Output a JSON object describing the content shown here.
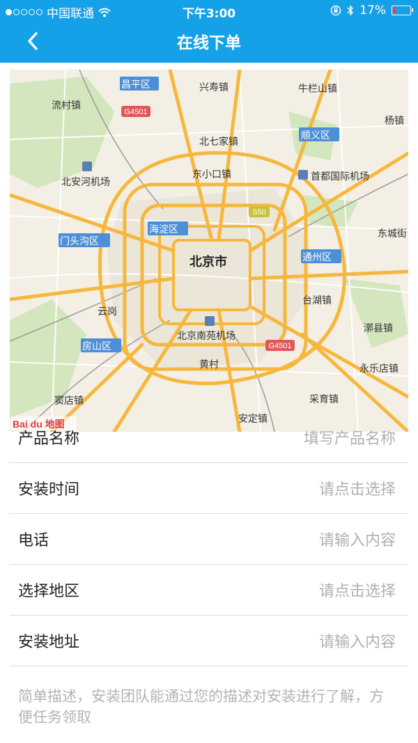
{
  "status": {
    "carrier": "中国联通",
    "time": "下午3:00",
    "battery": "17%",
    "battery_level": 0.17
  },
  "nav": {
    "title": "在线下单"
  },
  "map": {
    "logo_text": "Bai du 地图",
    "labels": [
      "昌平区",
      "兴寿镇",
      "牛栏山镇",
      "流村镇",
      "杨镇",
      "北七家镇",
      "顺义区",
      "北安河机场",
      "东小口镇",
      "首都国际机场",
      "门头沟区",
      "海淀区",
      "东城街",
      "北京市",
      "通州区",
      "台湖镇",
      "云岗",
      "房山区",
      "北京南苑机场",
      "漷县镇",
      "黄村",
      "永乐店镇",
      "窦店镇",
      "采育镇",
      "安定镇"
    ],
    "shields": [
      "G4501",
      "S50",
      "G4501"
    ]
  },
  "form": {
    "rows": [
      {
        "label": "产品名称",
        "hint": "填写产品名称"
      },
      {
        "label": "安装时间",
        "hint": "请点击选择"
      },
      {
        "label": "电话",
        "hint": "请输入内容"
      },
      {
        "label": "选择地区",
        "hint": "请点击选择"
      },
      {
        "label": "安装地址",
        "hint": "请输入内容"
      }
    ],
    "description_placeholder": "简单描述，安装团队能通过您的描述对安装进行了解，方便任务领取"
  }
}
